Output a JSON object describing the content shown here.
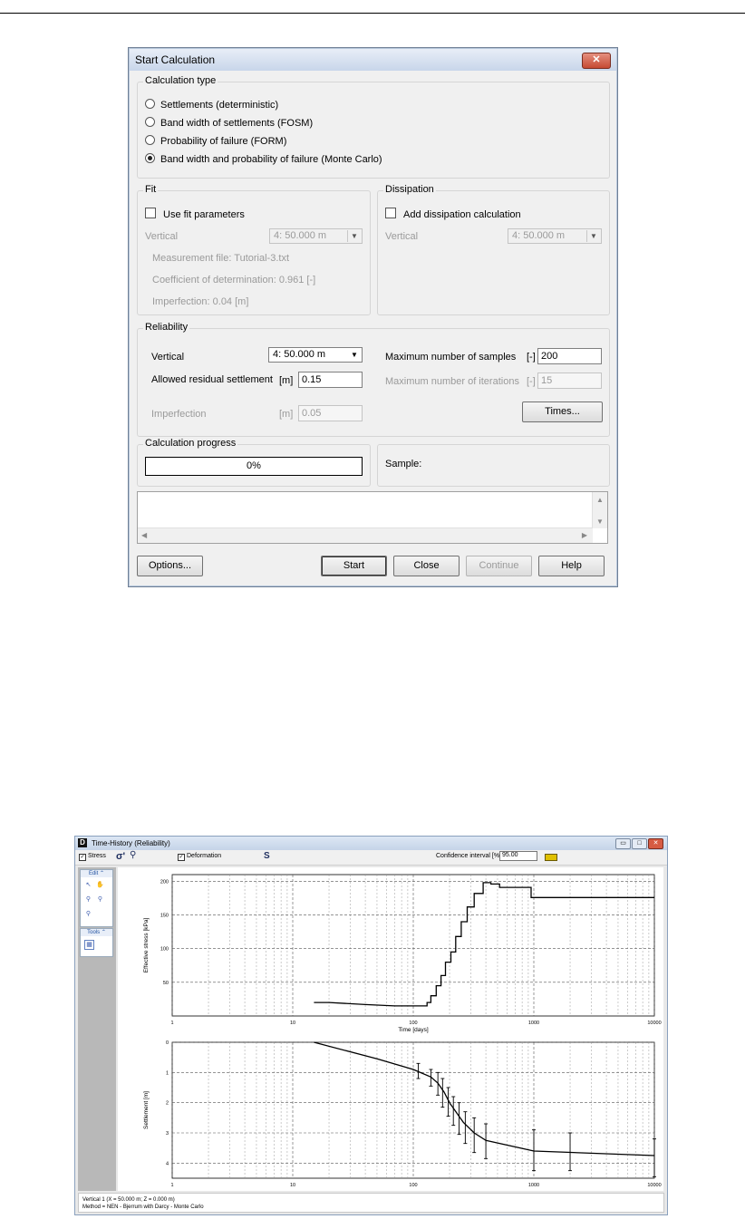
{
  "dialog": {
    "title": "Start Calculation",
    "close_glyph": "✕",
    "calc_type": {
      "legend": "Calculation type",
      "options": [
        {
          "label": "Settlements (deterministic)",
          "selected": false
        },
        {
          "label": "Band width of settlements (FOSM)",
          "selected": false
        },
        {
          "label": "Probability of failure (FORM)",
          "selected": false
        },
        {
          "label": "Band width and probability of failure (Monte Carlo)",
          "selected": true
        }
      ]
    },
    "fit": {
      "legend": "Fit",
      "use_fit_label": "Use fit parameters",
      "use_fit_checked": false,
      "vertical_label": "Vertical",
      "vertical_value": "4: 50.000 m",
      "measurement_file": "Measurement file: Tutorial-3.txt",
      "coefficient": "Coefficient of determination: 0.961 [-]",
      "imperfection": "Imperfection: 0.04 [m]"
    },
    "dissipation": {
      "legend": "Dissipation",
      "add_label": "Add dissipation calculation",
      "add_checked": false,
      "vertical_label": "Vertical",
      "vertical_value": "4: 50.000 m"
    },
    "reliability": {
      "legend": "Reliability",
      "vertical_label": "Vertical",
      "vertical_value": "4: 50.000 m",
      "allowed_label": "Allowed residual settlement",
      "allowed_unit": "[m]",
      "allowed_value": "0.15",
      "imperfection_label": "Imperfection",
      "imperfection_unit": "[m]",
      "imperfection_value": "0.05",
      "max_samples_label": "Maximum number of samples",
      "max_samples_unit": "[-]",
      "max_samples_value": "200",
      "max_iter_label": "Maximum number of iterations",
      "max_iter_unit": "[-]",
      "max_iter_value": "15",
      "times_button": "Times..."
    },
    "progress": {
      "legend": "Calculation progress",
      "value_text": "0%",
      "percent": 0,
      "sample_label": "Sample:"
    },
    "buttons": {
      "options": "Options...",
      "start": "Start",
      "close": "Close",
      "continue": "Continue",
      "help": "Help"
    }
  },
  "time_history": {
    "title": "Time-History (Reliability)",
    "logo_letter": "D",
    "toolbar": {
      "stress_label": "Stress",
      "stress_checked": true,
      "deformation_label": "Deformation",
      "deformation_checked": true,
      "sigma_glyph": "σ'",
      "s_glyph": "S",
      "confidence_label": "Confidence interval [%]",
      "confidence_value": "95.00"
    },
    "side": {
      "edit_label": "Edit",
      "tools_label": "Tools"
    },
    "status": [
      "Vertical 1 (X = 50.000 m; Z = 0.000 m)",
      "Method = NEN - Bjerrum with Darcy - Monte Carlo"
    ],
    "window_buttons": {
      "min": "▭",
      "max": "□",
      "close": "✕"
    }
  },
  "chart_data": [
    {
      "type": "line",
      "title": "",
      "xlabel": "Time [days]",
      "ylabel": "Effective stress [kPa]",
      "x_scale": "log",
      "xlim": [
        1,
        10000
      ],
      "ylim": [
        0,
        210
      ],
      "x_ticks": [
        "1",
        "10",
        "100",
        "1000",
        "10000"
      ],
      "y_ticks": [
        "50",
        "100",
        "150",
        "200"
      ],
      "grid": true,
      "series": [
        {
          "points": [
            [
              15,
              20
            ],
            [
              20,
              20
            ],
            [
              40,
              17
            ],
            [
              70,
              15
            ],
            [
              120,
              15
            ],
            [
              130,
              15
            ],
            [
              130,
              20
            ],
            [
              140,
              20
            ],
            [
              140,
              30
            ],
            [
              155,
              30
            ],
            [
              155,
              45
            ],
            [
              170,
              45
            ],
            [
              170,
              60
            ],
            [
              185,
              60
            ],
            [
              185,
              80
            ],
            [
              205,
              80
            ],
            [
              205,
              95
            ],
            [
              225,
              95
            ],
            [
              225,
              118
            ],
            [
              250,
              118
            ],
            [
              250,
              140
            ],
            [
              280,
              140
            ],
            [
              280,
              162
            ],
            [
              320,
              162
            ],
            [
              320,
              182
            ],
            [
              380,
              182
            ],
            [
              380,
              198
            ],
            [
              440,
              198
            ],
            [
              440,
              196
            ],
            [
              520,
              196
            ],
            [
              520,
              191
            ],
            [
              950,
              191
            ],
            [
              950,
              176
            ],
            [
              10000,
              176
            ]
          ]
        }
      ]
    },
    {
      "type": "line",
      "title": "",
      "xlabel": "",
      "ylabel": "Settlement [m]",
      "x_scale": "log",
      "xlim": [
        1,
        10000
      ],
      "ylim": [
        4.5,
        0
      ],
      "x_ticks": [
        "1",
        "10",
        "100",
        "1000",
        "10000"
      ],
      "y_ticks": [
        "0",
        "1",
        "2",
        "3",
        "4"
      ],
      "grid": true,
      "series": [
        {
          "points": [
            [
              15,
              0
            ],
            [
              50,
              0.55
            ],
            [
              100,
              0.9
            ],
            [
              140,
              1.15
            ],
            [
              160,
              1.35
            ],
            [
              180,
              1.65
            ],
            [
              200,
              2.0
            ],
            [
              230,
              2.35
            ],
            [
              260,
              2.65
            ],
            [
              320,
              3.0
            ],
            [
              400,
              3.25
            ],
            [
              1000,
              3.6
            ],
            [
              10000,
              3.75
            ]
          ],
          "error_bars": [
            {
              "x": 110,
              "lo": 0.7,
              "hi": 1.2
            },
            {
              "x": 140,
              "lo": 0.9,
              "hi": 1.45
            },
            {
              "x": 160,
              "lo": 1.0,
              "hi": 1.75
            },
            {
              "x": 175,
              "lo": 1.2,
              "hi": 2.15
            },
            {
              "x": 195,
              "lo": 1.5,
              "hi": 2.45
            },
            {
              "x": 215,
              "lo": 1.8,
              "hi": 2.75
            },
            {
              "x": 240,
              "lo": 2.0,
              "hi": 3.05
            },
            {
              "x": 270,
              "lo": 2.3,
              "hi": 3.35
            },
            {
              "x": 320,
              "lo": 2.5,
              "hi": 3.65
            },
            {
              "x": 400,
              "lo": 2.7,
              "hi": 3.85
            },
            {
              "x": 1000,
              "lo": 2.9,
              "hi": 4.25
            },
            {
              "x": 2000,
              "lo": 3.0,
              "hi": 4.25
            },
            {
              "x": 10000,
              "lo": 3.2,
              "hi": 4.45
            }
          ]
        }
      ]
    }
  ]
}
